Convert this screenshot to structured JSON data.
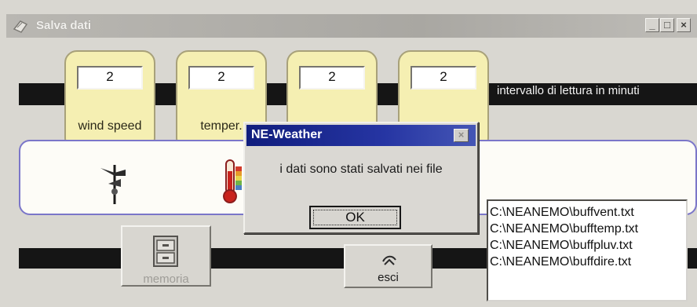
{
  "window": {
    "title": "Salva dati",
    "controls": {
      "minimize": "_",
      "maximize": "□",
      "close": "×"
    }
  },
  "intervals": {
    "caption": "intervallo di lettura in minuti",
    "cards": [
      {
        "value": "2",
        "label": "wind speed"
      },
      {
        "value": "2",
        "label": "temper."
      },
      {
        "value": "2",
        "label": ""
      },
      {
        "value": "2",
        "label": ""
      }
    ]
  },
  "sensors": {
    "icons": [
      "wind-vane-icon",
      "thermometer-icon"
    ]
  },
  "buttons": {
    "memoria": "memoria",
    "esci": "esci"
  },
  "files": [
    "C:\\NEANEMO\\buffvent.txt",
    "C:\\NEANEMO\\bufftemp.txt",
    "C:\\NEANEMO\\buffpluv.txt",
    "C:\\NEANEMO\\buffdire.txt"
  ],
  "dialog": {
    "title": "NE-Weather",
    "message": "i dati sono stati salvati nei file",
    "ok_label": "OK",
    "close": "×"
  },
  "colors": {
    "dialog_title": "#101d7d",
    "card_fill": "#f5efb2",
    "panel_border": "#7b76c9",
    "bar": "#151515"
  }
}
